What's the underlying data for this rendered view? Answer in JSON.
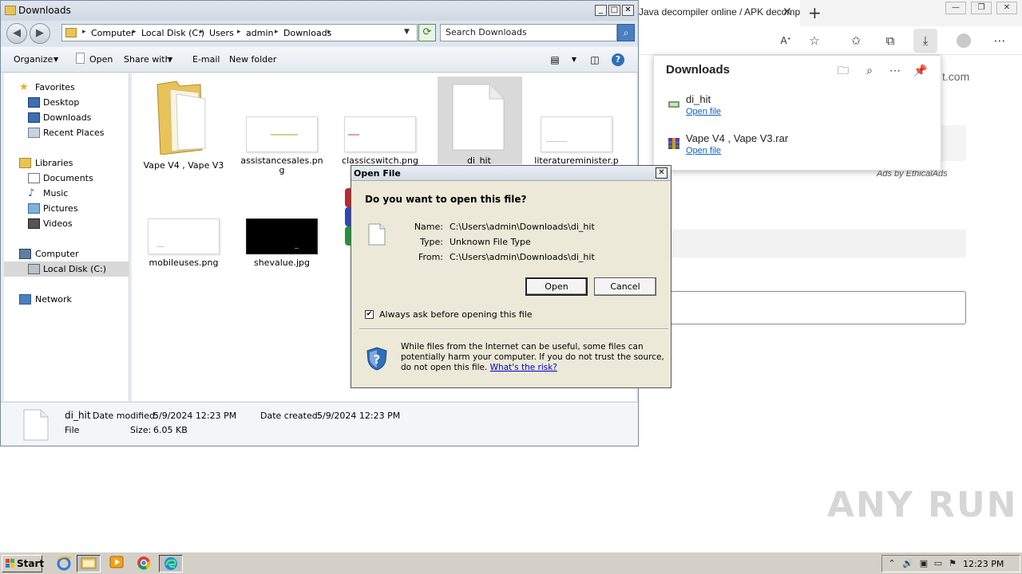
{
  "browser": {
    "tab_title": "Java decompiler online / APK decompiler",
    "page": {
      "domain_suffix": "t.com",
      "ads_text": "Ads by EthicalAds"
    }
  },
  "downloads_panel": {
    "title": "Downloads",
    "items": [
      {
        "name": "di_hit",
        "action": "Open file"
      },
      {
        "name": "Vape V4 , Vape V3.rar",
        "action": "Open file"
      }
    ]
  },
  "explorer": {
    "title": "Downloads",
    "breadcrumb": [
      "Computer",
      "Local Disk (C:)",
      "Users",
      "admin",
      "Downloads"
    ],
    "search_placeholder": "Search Downloads",
    "commands": {
      "organize": "Organize",
      "open": "Open",
      "share_with": "Share with",
      "email": "E-mail",
      "new_folder": "New folder"
    },
    "nav": {
      "favorites": "Favorites",
      "desktop": "Desktop",
      "downloads": "Downloads",
      "recent_places": "Recent Places",
      "libraries": "Libraries",
      "documents": "Documents",
      "music": "Music",
      "pictures": "Pictures",
      "videos": "Videos",
      "computer": "Computer",
      "local_disk": "Local Disk (C:)",
      "network": "Network"
    },
    "files": [
      "Vape V4 , Vape V3",
      "assistancesales.png",
      "classicswitch.png",
      "di_hit",
      "literatureminister.p",
      "mobileuses.png",
      "shevalue.jpg"
    ],
    "details": {
      "name": "di_hit",
      "type": "File",
      "date_modified_label": "Date modified:",
      "date_modified": "5/9/2024 12:23 PM",
      "date_created_label": "Date created:",
      "date_created": "5/9/2024 12:23 PM",
      "size_label": "Size:",
      "size": "6.05 KB"
    }
  },
  "dialog": {
    "title": "Open File",
    "question": "Do you want to open this file?",
    "name_label": "Name:",
    "name_value": "C:\\Users\\admin\\Downloads\\di_hit",
    "type_label": "Type:",
    "type_value": "Unknown File Type",
    "from_label": "From:",
    "from_value": "C:\\Users\\admin\\Downloads\\di_hit",
    "open_button": "Open",
    "cancel_button": "Cancel",
    "checkbox_label": "Always ask before opening this file",
    "checkbox_checked": true,
    "warning_text": "While files from the Internet can be useful, some files can potentially harm your computer. If you do not trust the source, do not open this file.",
    "risk_link": "What's the risk?"
  },
  "taskbar": {
    "start_label": "Start",
    "clock": "12:23 PM"
  },
  "watermark": "ANY RUN"
}
